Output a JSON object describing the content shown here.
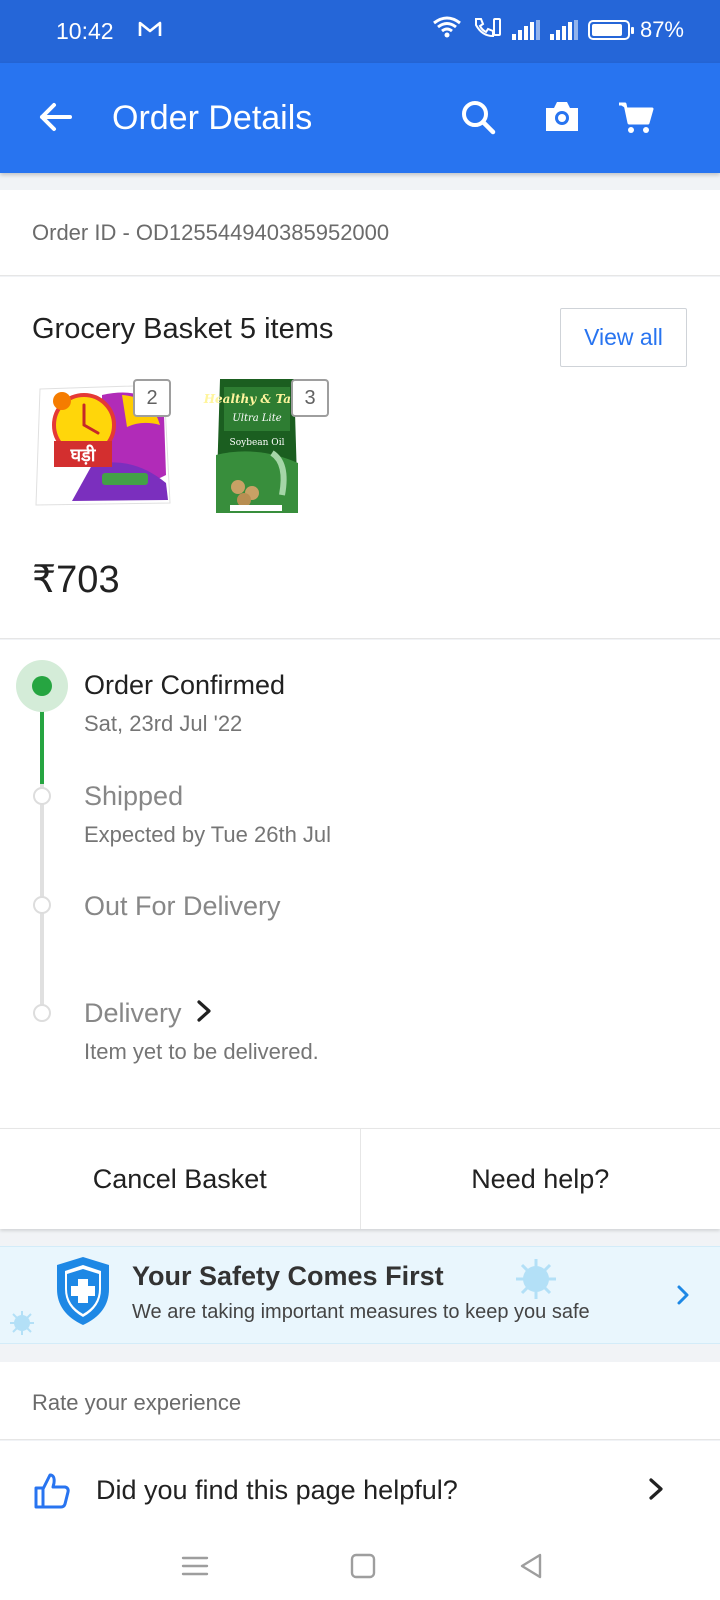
{
  "status_bar": {
    "time": "10:42",
    "gmail_icon": "gmail-icon",
    "battery": "87%",
    "battery_level": 0.87
  },
  "app_bar": {
    "title": "Order Details",
    "icons": [
      "back-arrow-icon",
      "search-icon",
      "camera-icon",
      "cart-icon"
    ]
  },
  "order": {
    "id_label": "Order ID - OD125544940385952000"
  },
  "basket": {
    "title": "Grocery Basket 5 items",
    "view_all": "View all",
    "items": [
      {
        "name": "Ghadi detergent",
        "qty": "2"
      },
      {
        "name": "Healthy & Tasty Soybean Oil",
        "qty": "3"
      }
    ],
    "product_text": {
      "ghadi": "घड़ी",
      "oil_brand": "Healthy & Tasty",
      "oil_line": "Ultra Lite",
      "oil_type": "Soybean Oil"
    },
    "price": "₹703"
  },
  "tracking": {
    "steps": [
      {
        "title": "Order Confirmed",
        "subtitle": "Sat, 23rd Jul '22",
        "state": "done"
      },
      {
        "title": "Shipped",
        "subtitle": "Expected by Tue 26th Jul",
        "state": "pending"
      },
      {
        "title": "Out For Delivery",
        "subtitle": "",
        "state": "pending"
      },
      {
        "title": "Delivery",
        "subtitle": "Item yet to be delivered.",
        "state": "pending"
      }
    ]
  },
  "actions": {
    "cancel": "Cancel Basket",
    "help": "Need help?"
  },
  "safety_banner": {
    "title": "Your Safety Comes First",
    "subtitle": "We are taking important measures to keep you safe"
  },
  "rating": {
    "label": "Rate your experience",
    "helpful_question": "Did you find this page helpful?"
  },
  "colors": {
    "status_bar": "#2566d8",
    "app_bar": "#2874f0",
    "accent_green": "#26a541",
    "link_blue": "#2874f0",
    "safety_bg": "#e9f6fd"
  }
}
